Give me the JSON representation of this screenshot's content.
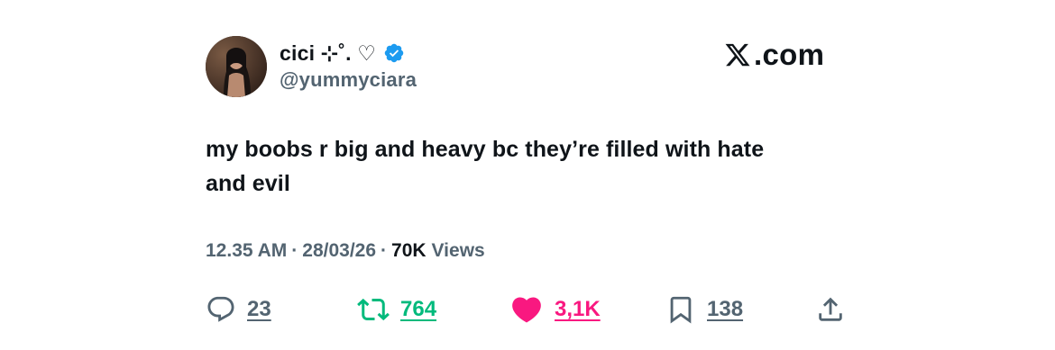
{
  "author": {
    "display_name": "cici ⊹˚. ♡",
    "handle": "@yummyciara",
    "verified": true
  },
  "brand": {
    "text": "X.com",
    "icon": "x-logo-icon"
  },
  "tweet": {
    "text_line1": "my boobs r big and heavy bc they’re filled with hate",
    "text_line2": "and evil",
    "time": "12.35 AM",
    "date": "28/03/26",
    "views_count": "70K",
    "views_label": "Views",
    "separator": "·"
  },
  "actions": {
    "reply": {
      "icon": "reply-icon",
      "count": "23"
    },
    "retweet": {
      "icon": "retweet-icon",
      "count": "764"
    },
    "like": {
      "icon": "heart-icon",
      "count": "3,1K"
    },
    "bookmark": {
      "icon": "bookmark-icon",
      "count": "138"
    },
    "share": {
      "icon": "share-icon"
    }
  },
  "colors": {
    "text": "#0f1419",
    "muted": "#536471",
    "verified": "#1d9bf0",
    "retweet": "#00ba7c",
    "like": "#f91880"
  }
}
